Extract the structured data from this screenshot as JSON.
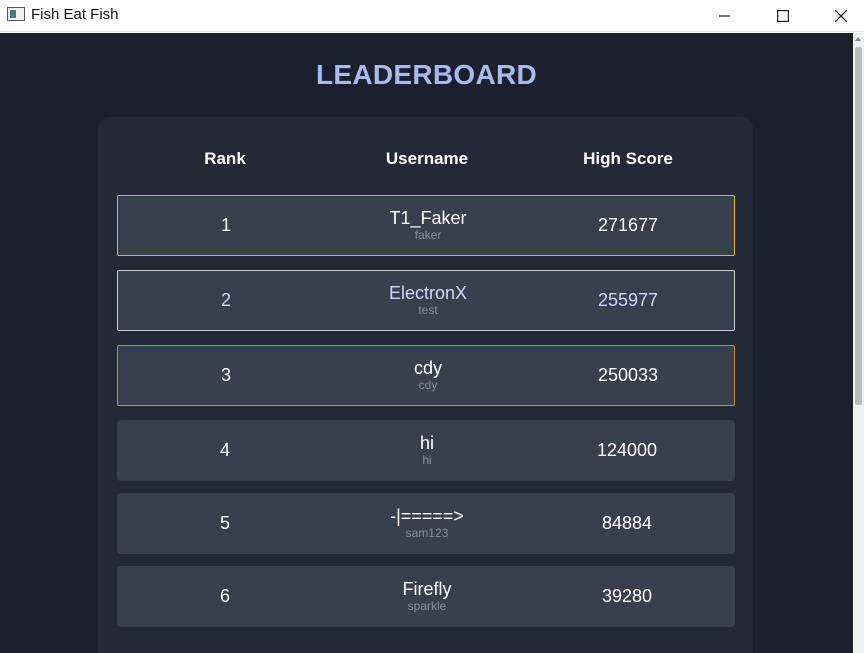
{
  "window": {
    "title": "Fish Eat Fish"
  },
  "leaderboard": {
    "heading": "LEADERBOARD",
    "columns": {
      "rank": "Rank",
      "username": "Username",
      "score": "High Score"
    },
    "rows": [
      {
        "rank": "1",
        "username": "T1_Faker",
        "login": "faker",
        "score": "271677"
      },
      {
        "rank": "2",
        "username": "ElectronX",
        "login": "test",
        "score": "255977"
      },
      {
        "rank": "3",
        "username": "cdy",
        "login": "cdy",
        "score": "250033"
      },
      {
        "rank": "4",
        "username": "hi",
        "login": "hi",
        "score": "124000"
      },
      {
        "rank": "5",
        "username": "-|=====>",
        "login": "sam123",
        "score": "84884"
      },
      {
        "rank": "6",
        "username": "Firefly",
        "login": "sparkle",
        "score": "39280"
      }
    ]
  },
  "colors": {
    "heading": "#a9b9ee",
    "background": "#1b212c",
    "panel": "#232a36",
    "row": "#383f4d",
    "gold": "#e3b23c",
    "silver": "#c9ccd3",
    "bronze": "#c98a3a"
  }
}
